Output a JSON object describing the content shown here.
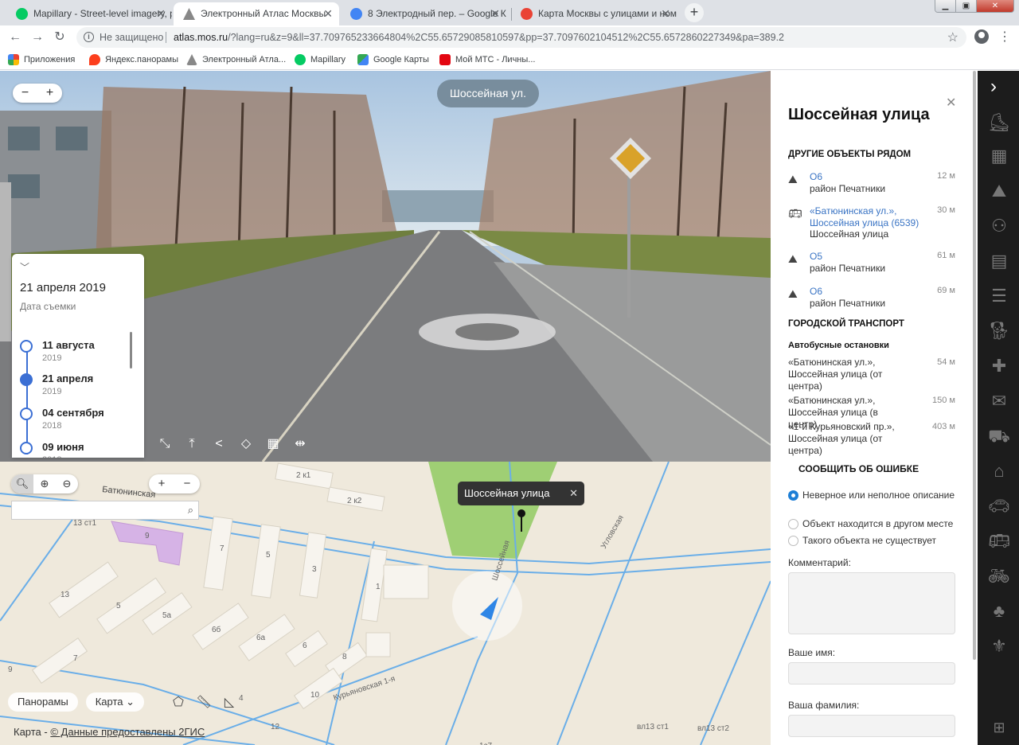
{
  "browser": {
    "tabs": [
      {
        "title": "Mapillary - Street-level imagery, p",
        "favicon_color": "#05cb63"
      },
      {
        "title": "Электронный Атлас Москвы",
        "favicon_color": "#888888"
      },
      {
        "title": "8 Электродный пер. – Google Ка",
        "favicon_color": "#4285f4"
      },
      {
        "title": "Карта Москвы с улицами и ном",
        "favicon_color": "#ea4335"
      }
    ],
    "insecure_label": "Не защищено",
    "url_host": "atlas.mos.ru",
    "url_path": "/?lang=ru&z=9&ll=37.709765233664804%2C55.65729085810597&pp=37.7097602104512%2C55.6572860227349&pa=389.2",
    "bookmarks": [
      {
        "label": "Приложения",
        "color": "#ea4335"
      },
      {
        "label": "Яндекс.панорамы",
        "color": "#fc3f1d"
      },
      {
        "label": "Электронный Атла...",
        "color": "#888888"
      },
      {
        "label": "Mapillary",
        "color": "#05cb63"
      },
      {
        "label": "Google Карты",
        "color": "#34a853"
      },
      {
        "label": "Мой МТС - Личны...",
        "color": "#e30611"
      }
    ]
  },
  "panorama": {
    "street_chip": "Шоссейная ул.",
    "zoom_out": "−",
    "zoom_in": "+",
    "current_date": "21 апреля 2019",
    "date_caption": "Дата съемки",
    "dates": [
      {
        "date": "11 августа",
        "year": "2019",
        "selected": false
      },
      {
        "date": "21 апреля",
        "year": "2019",
        "selected": true
      },
      {
        "date": "04 сентября",
        "year": "2018",
        "selected": false
      },
      {
        "date": "09 июня",
        "year": "2018",
        "selected": false
      }
    ]
  },
  "map": {
    "popup_title": "Шоссейная улица",
    "street_label": "Батюнинская",
    "buttons": {
      "panoramas": "Панорамы",
      "map": "Карта"
    },
    "copyright_prefix": "Карта - ",
    "copyright_link": "© Данные предоставлены 2ГИС",
    "labels": [
      "2 к1",
      "2 к2",
      "13 ст1",
      "9",
      "7",
      "5",
      "3",
      "1",
      "13",
      "5",
      "5а",
      "6б",
      "6а",
      "6",
      "8",
      "7",
      "9",
      "10",
      "4",
      "12",
      "1с7",
      "вл13 ст1",
      "вл13 ст2",
      "Курьяновская 1-я",
      "Шоссейная",
      "Угловская"
    ]
  },
  "panel": {
    "title": "Шоссейная улица",
    "nearby_header": "ДРУГИЕ ОБЪЕКТЫ РЯДОМ",
    "nearby": [
      {
        "icon": "district-icon",
        "name": "О6",
        "desc": "район Печатники",
        "dist": "12 м"
      },
      {
        "icon": "bus-icon",
        "name": "«Батюнинская ул.», Шоссейная улица (6539)",
        "desc": "Шоссейная улица",
        "dist": "30 м"
      },
      {
        "icon": "district-icon",
        "name": "О5",
        "desc": "район Печатники",
        "dist": "61 м"
      },
      {
        "icon": "district-icon",
        "name": "О6",
        "desc": "район Печатники",
        "dist": "69 м"
      }
    ],
    "transport_header": "ГОРОДСКОЙ ТРАНСПОРТ",
    "bus_header": "Автобусные остановки",
    "stops": [
      {
        "name": "«Батюнинская ул.», Шоссейная улица (от центра)",
        "dist": "54 м"
      },
      {
        "name": "«Батюнинская ул.», Шоссейная улица (в центр)",
        "dist": "150 м"
      },
      {
        "name": "«1-й Курьяновский пр.», Шоссейная улица (от центра)",
        "dist": "403 м"
      }
    ],
    "report_label": "СООБЩИТЬ ОБ ОШИБКЕ",
    "report_options": [
      {
        "label": "Неверное или неполное описание",
        "checked": true
      },
      {
        "label": "Объект находится в другом месте",
        "checked": false
      },
      {
        "label": "Такого объекта не существует",
        "checked": false
      }
    ],
    "comment_label": "Комментарий:",
    "name_label": "Ваше имя:",
    "surname_label": "Ваша фамилия:"
  }
}
